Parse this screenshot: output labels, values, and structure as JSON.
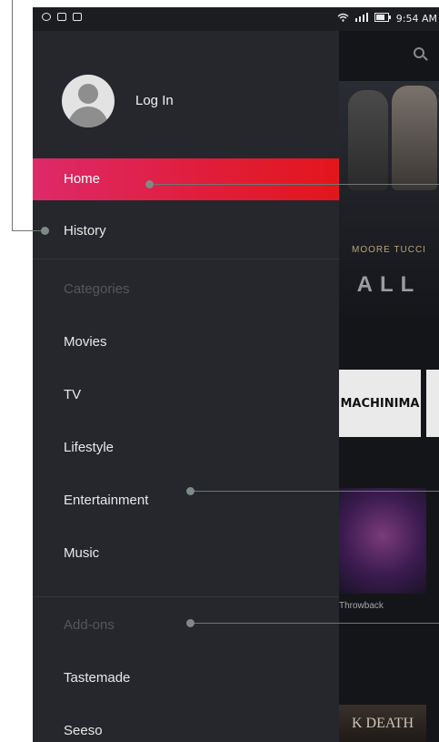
{
  "status_bar": {
    "left_icons": [
      "chat-icon",
      "mail-icon",
      "image-icon"
    ],
    "right_icons": [
      "wifi-icon",
      "signal-icon",
      "battery-icon"
    ],
    "time": "9:54 AM"
  },
  "profile": {
    "login_label": "Log In"
  },
  "menu": {
    "home": "Home",
    "history": "History",
    "categories_header": "Categories",
    "movies": "Movies",
    "tv": "TV",
    "lifestyle": "Lifestyle",
    "entertainment": "Entertainment",
    "music": "Music",
    "addons_header": "Add-ons",
    "tastemade": "Tastemade",
    "seeso": "Seeso"
  },
  "background": {
    "poster1_names": "MOORE  TUCCI",
    "poster1_title": "ALL",
    "poster2_label": "MACHINIMA",
    "poster3_caption": "Throwback",
    "poster4_label": "K DEATH"
  },
  "colors": {
    "accent_start": "#de2a6a",
    "accent_end": "#e3161b",
    "drawer_bg": "#25272c",
    "header_text": "#55575d"
  }
}
